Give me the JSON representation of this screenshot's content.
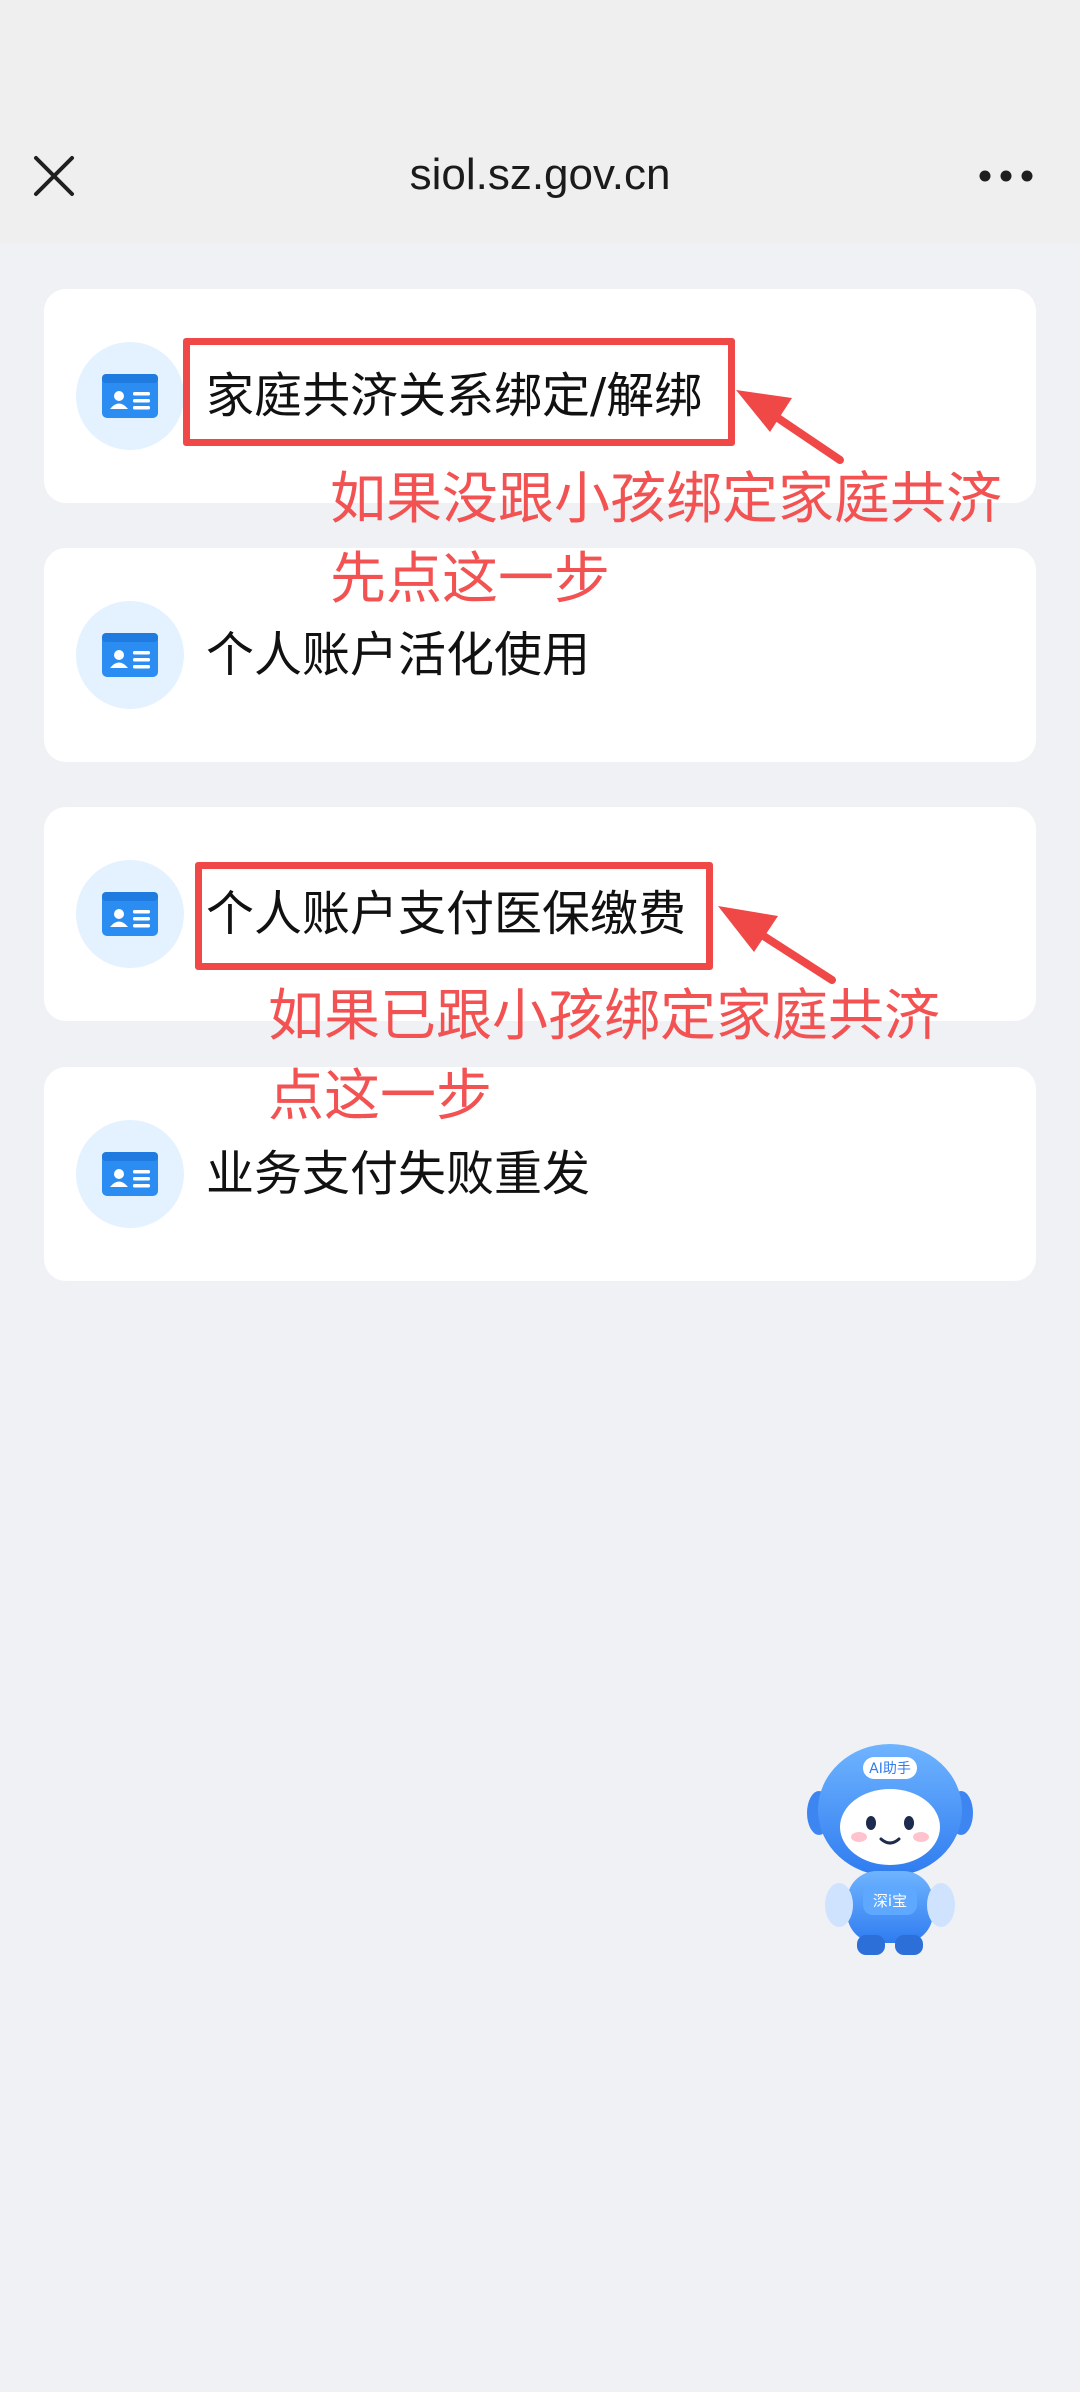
{
  "status_bar": {},
  "nav": {
    "title": "siol.sz.gov.cn",
    "close_icon": "close-icon",
    "more_icon": "more-dots-icon"
  },
  "menu": {
    "items": [
      {
        "label": "家庭共济关系绑定/解绑",
        "icon": "id-card-icon"
      },
      {
        "label": "个人账户活化使用",
        "icon": "id-card-icon"
      },
      {
        "label": "个人账户支付医保缴费",
        "icon": "id-card-icon"
      },
      {
        "label": "业务支付失败重发",
        "icon": "id-card-icon"
      }
    ]
  },
  "annotations": {
    "first": {
      "line1": "如果没跟小孩绑定家庭共济",
      "line2": "先点这一步"
    },
    "second": {
      "line1": "如果已跟小孩绑定家庭共济",
      "line2": "点这一步"
    },
    "color": "#f25252"
  },
  "mascot": {
    "badge_text": "AI助手",
    "body_text": "深i宝"
  },
  "colors": {
    "background": "#f0f1f5",
    "card": "#ffffff",
    "icon_bg": "#e4f2ff",
    "icon_blue": "#2b8cf2",
    "highlight": "#f04747"
  }
}
